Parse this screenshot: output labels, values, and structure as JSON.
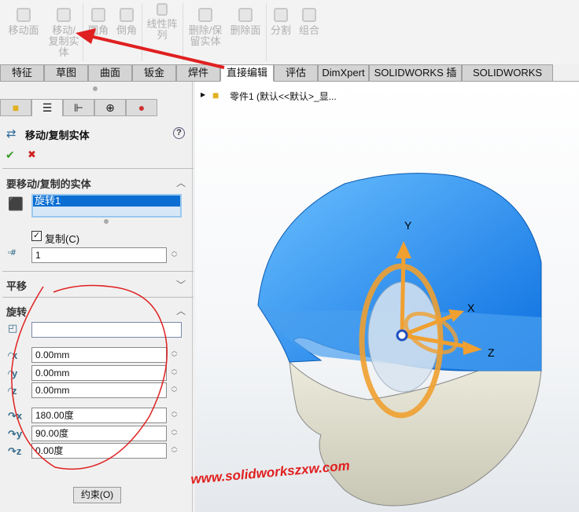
{
  "toolbar": {
    "items": [
      {
        "label": "移动面",
        "icon": "move-face-icon"
      },
      {
        "label": "移动/\n复制实\n体",
        "icon": "move-copy-body-icon"
      },
      {
        "label": "圆角",
        "icon": "fillet-icon"
      },
      {
        "label": "倒角",
        "icon": "chamfer-icon"
      },
      {
        "label": "线性阵\n列",
        "icon": "linear-pattern-icon"
      },
      {
        "label": "删除/保\n留实体",
        "icon": "delete-keep-body-icon"
      },
      {
        "label": "删除面",
        "icon": "delete-face-icon"
      },
      {
        "label": "分割",
        "icon": "split-icon"
      },
      {
        "label": "组合",
        "icon": "combine-icon"
      }
    ]
  },
  "tabs": [
    "特征",
    "草图",
    "曲面",
    "钣金",
    "焊件",
    "直接编辑",
    "评估",
    "DimXpert",
    "SOLIDWORKS 插件",
    "SOLIDWORKS MBD"
  ],
  "active_tab": "直接编辑",
  "panel": {
    "title": "移动/复制实体",
    "help": "?",
    "ok": "✔",
    "cancel": "✖",
    "bodies_section": "要移动/复制的实体",
    "selected_body": "旋转1",
    "copy_label": "复制(C)",
    "copy_checked": true,
    "copy_count": "1",
    "translate_section": "平移",
    "rotate_section": "旋转",
    "rotate_ref": "",
    "x": "0.00mm",
    "y": "0.00mm",
    "z": "0.00mm",
    "rx": "180.00度",
    "ry": "90.00度",
    "rz": "0.00度",
    "constraints_button": "约束(O)"
  },
  "viewport": {
    "tree_item": "零件1  (默认<<默认>_显...",
    "axes": {
      "x": "X",
      "y": "Y",
      "z": "Z"
    }
  },
  "watermark": "www.solidworkszxw.com",
  "colors": {
    "model_blue": "#1e8cf0",
    "triad_orange": "#f0a030",
    "annotation_red": "#e02020"
  }
}
